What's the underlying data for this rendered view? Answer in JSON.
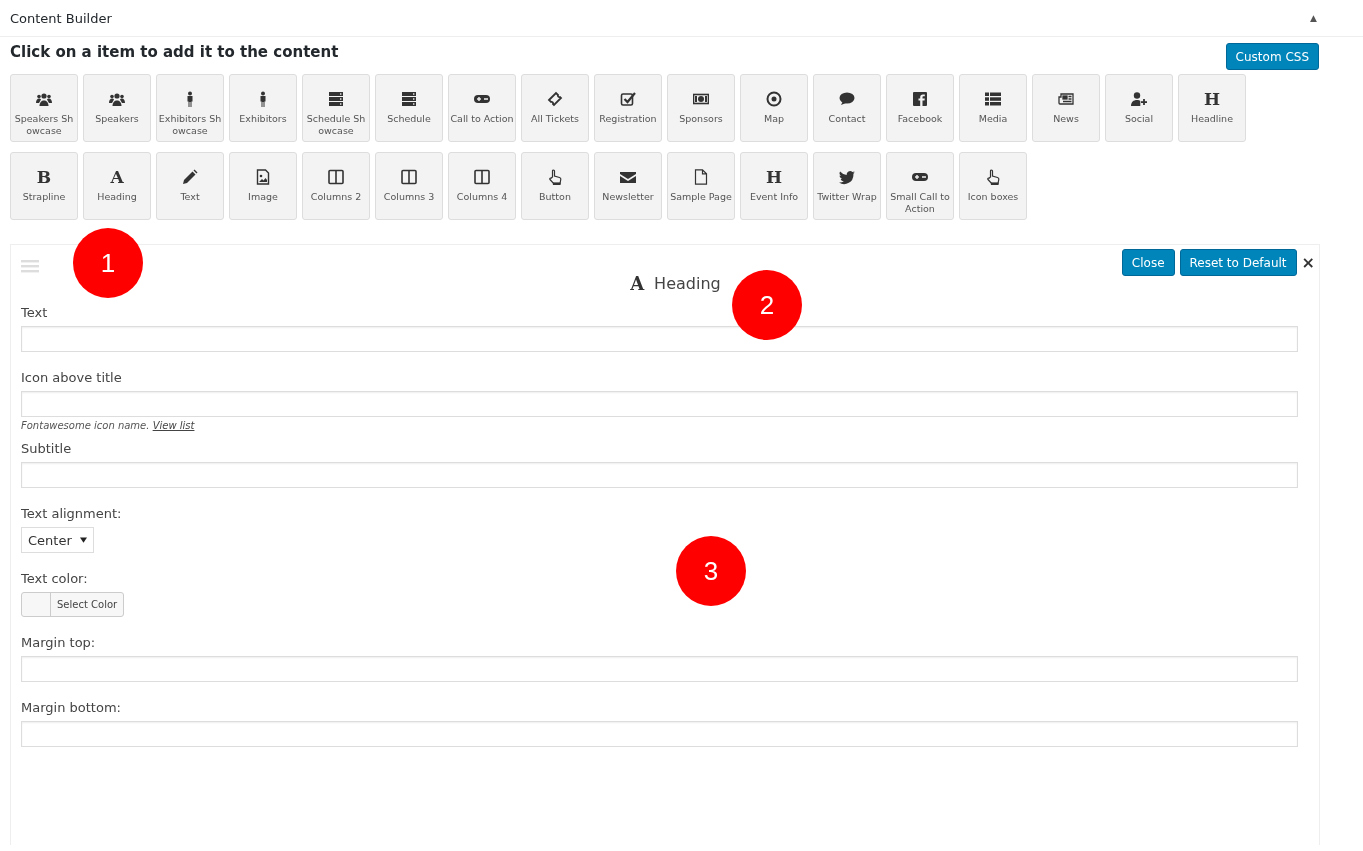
{
  "header": {
    "title": "Content Builder",
    "toggle": "▲"
  },
  "instructions": "Click on a item to add it to the content",
  "custom_css_button": "Custom CSS",
  "tile_rows": [
    [
      {
        "label": "Speakers Showcase",
        "kind": "group"
      },
      {
        "label": "Speakers",
        "kind": "group"
      },
      {
        "label": "Exhibitors Showcase",
        "kind": "person"
      },
      {
        "label": "Exhibitors",
        "kind": "person"
      },
      {
        "label": "Schedule Showcase",
        "kind": "server"
      },
      {
        "label": "Schedule",
        "kind": "server"
      },
      {
        "label": "Call to Action",
        "kind": "gamepad"
      },
      {
        "label": "All Tickets",
        "kind": "ticket"
      },
      {
        "label": "Registration",
        "kind": "check"
      },
      {
        "label": "Sponsors",
        "kind": "money"
      },
      {
        "label": "Map",
        "kind": "target"
      },
      {
        "label": "Contact",
        "kind": "comment"
      },
      {
        "label": "Facebook",
        "kind": "facebook"
      },
      {
        "label": "Media",
        "kind": "list"
      },
      {
        "label": "News",
        "kind": "newspaper"
      },
      {
        "label": "Social",
        "kind": "user-plus"
      },
      {
        "label": "Headline",
        "kind": "letter",
        "glyph": "H"
      }
    ],
    [
      {
        "label": "Strapline",
        "kind": "letter",
        "glyph": "B"
      },
      {
        "label": "Heading",
        "kind": "letter",
        "glyph": "A"
      },
      {
        "label": "Text",
        "kind": "pencil"
      },
      {
        "label": "Image",
        "kind": "image"
      },
      {
        "label": "Columns 2",
        "kind": "columns"
      },
      {
        "label": "Columns 3",
        "kind": "columns"
      },
      {
        "label": "Columns 4",
        "kind": "columns"
      },
      {
        "label": "Button",
        "kind": "hand"
      },
      {
        "label": "Newsletter",
        "kind": "envelope"
      },
      {
        "label": "Sample Page",
        "kind": "file"
      },
      {
        "label": "Event Info",
        "kind": "letter",
        "glyph": "H"
      },
      {
        "label": "Twitter Wrap",
        "kind": "twitter"
      },
      {
        "label": "Small Call to Action",
        "kind": "gamepad"
      },
      {
        "label": "Icon boxes",
        "kind": "hand"
      }
    ]
  ],
  "panel": {
    "glyph": "A",
    "title": "Heading",
    "close_button": "Close",
    "reset_button": "Reset to Default",
    "remove": "×",
    "fields": [
      {
        "kind": "text",
        "label": "Text"
      },
      {
        "kind": "text",
        "label": "Icon above title",
        "help": "Fontawesome icon name.",
        "help_link": "View list"
      },
      {
        "kind": "text",
        "label": "Subtitle"
      },
      {
        "kind": "select",
        "label": "Text alignment:",
        "value": "Center"
      },
      {
        "kind": "color",
        "label": "Text color:",
        "button": "Select Color"
      },
      {
        "kind": "text",
        "label": "Margin top:"
      },
      {
        "kind": "text",
        "label": "Margin bottom:"
      }
    ]
  },
  "annotations": [
    "1",
    "2",
    "3"
  ]
}
